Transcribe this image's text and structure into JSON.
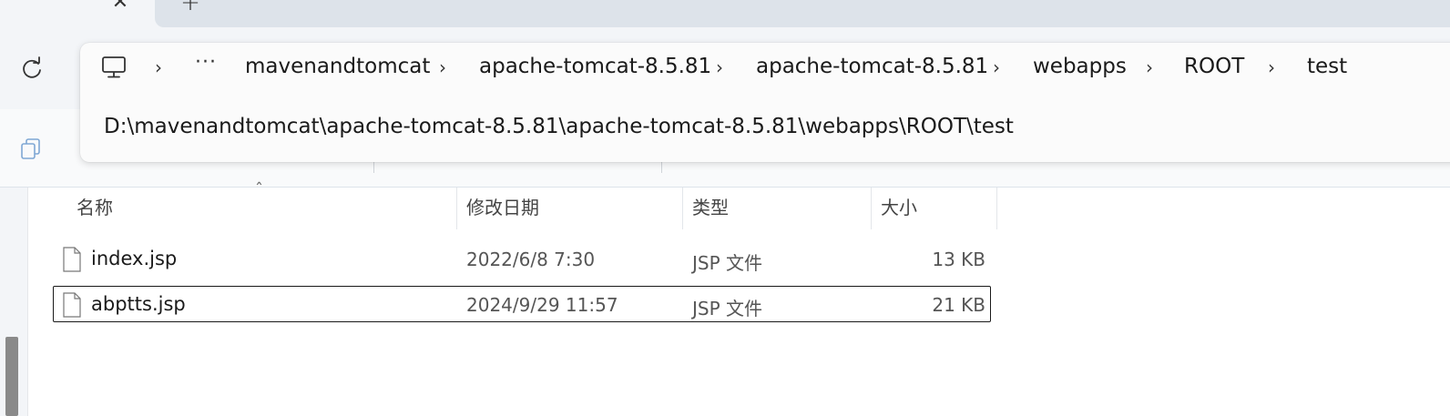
{
  "tabs": {
    "close_glyph": "✕",
    "new_tab_glyph": "+"
  },
  "nav": {
    "refresh_icon": "refresh-icon"
  },
  "address": {
    "breadcrumbs": [
      "mavenandtomcat",
      "apache-tomcat-8.5.81",
      "apache-tomcat-8.5.81",
      "webapps",
      "ROOT",
      "test"
    ],
    "overflow": "···",
    "separator": "›",
    "dropdown_path": "D:\\mavenandtomcat\\apache-tomcat-8.5.81\\apache-tomcat-8.5.81\\webapps\\ROOT\\test",
    "root_icon": "computer-icon"
  },
  "columns": {
    "name": "名称",
    "modified": "修改日期",
    "type": "类型",
    "size": "大小"
  },
  "files": [
    {
      "name": "index.jsp",
      "modified": "2022/6/8 7:30",
      "type": "JSP 文件",
      "size": "13 KB"
    },
    {
      "name": "abptts.jsp",
      "modified": "2024/9/29 11:57",
      "type": "JSP 文件",
      "size": "21 KB"
    }
  ],
  "colors": {
    "chrome_bg": "#f3f5f8",
    "inactive_tab": "#dde3ea",
    "focus_border": "#1a1a1a"
  }
}
